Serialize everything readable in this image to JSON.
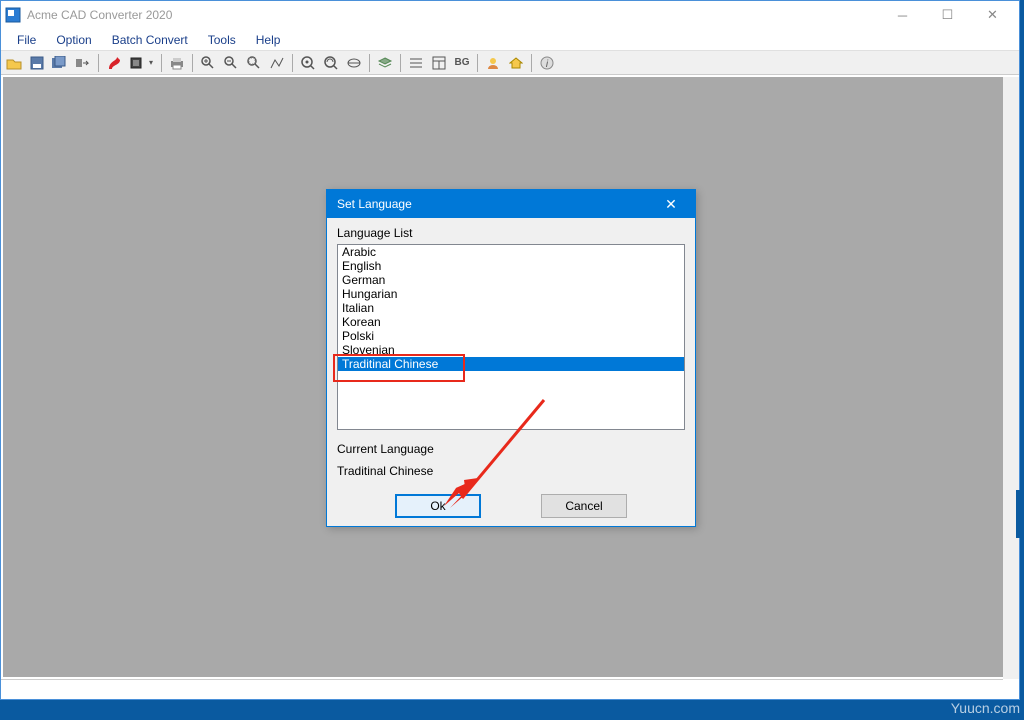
{
  "app": {
    "title": "Acme CAD Converter 2020"
  },
  "menu": {
    "file": "File",
    "option": "Option",
    "batch": "Batch Convert",
    "tools": "Tools",
    "help": "Help"
  },
  "toolbar_icons": {
    "open": "open",
    "save": "save",
    "saveall": "saveall",
    "convert": "convert",
    "pdf": "pdf",
    "dwg": "dwg",
    "print": "print",
    "zoomin": "zoomin",
    "zoomout": "zoomout",
    "zoomwin": "zoomwin",
    "zoomext": "zoomext",
    "pan": "pan",
    "rotate": "rotate",
    "view3d": "view3d",
    "layers": "layers",
    "list": "list",
    "props": "props",
    "bg": "BG",
    "user": "user",
    "home": "home",
    "info": "info"
  },
  "dialog": {
    "title": "Set Language",
    "list_label": "Language List",
    "items": [
      "Arabic",
      "English",
      "German",
      "Hungarian",
      "Italian",
      "Korean",
      "Polski",
      "Slovenian",
      "Traditinal Chinese"
    ],
    "selected_index": 8,
    "current_label": "Current Language",
    "current_value": "Traditinal Chinese",
    "ok": "Ok",
    "cancel": "Cancel"
  },
  "watermark": "Yuucn.com"
}
